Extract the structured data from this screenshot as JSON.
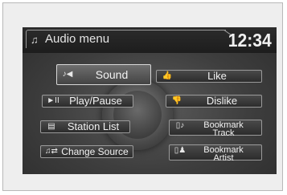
{
  "header": {
    "title": "Audio menu",
    "time": "12:34"
  },
  "buttons": {
    "sound": "Sound",
    "like": "Like",
    "play_pause": "Play/Pause",
    "dislike": "Dislike",
    "station_list": "Station List",
    "bookmark_track_line1": "Bookmark",
    "bookmark_track_line2": "Track",
    "change_source": "Change Source",
    "bookmark_artist_line1": "Bookmark",
    "bookmark_artist_line2": "Artist"
  },
  "icons": {
    "title": "music-note-icon",
    "sound": "speaker-icon",
    "like": "thumbs-up-icon",
    "play_pause": "play-pause-icon",
    "dislike": "thumbs-down-icon",
    "station_list": "list-icon",
    "bookmark_track": "bookmark-track-icon",
    "change_source": "change-source-icon",
    "bookmark_artist": "bookmark-artist-icon"
  }
}
